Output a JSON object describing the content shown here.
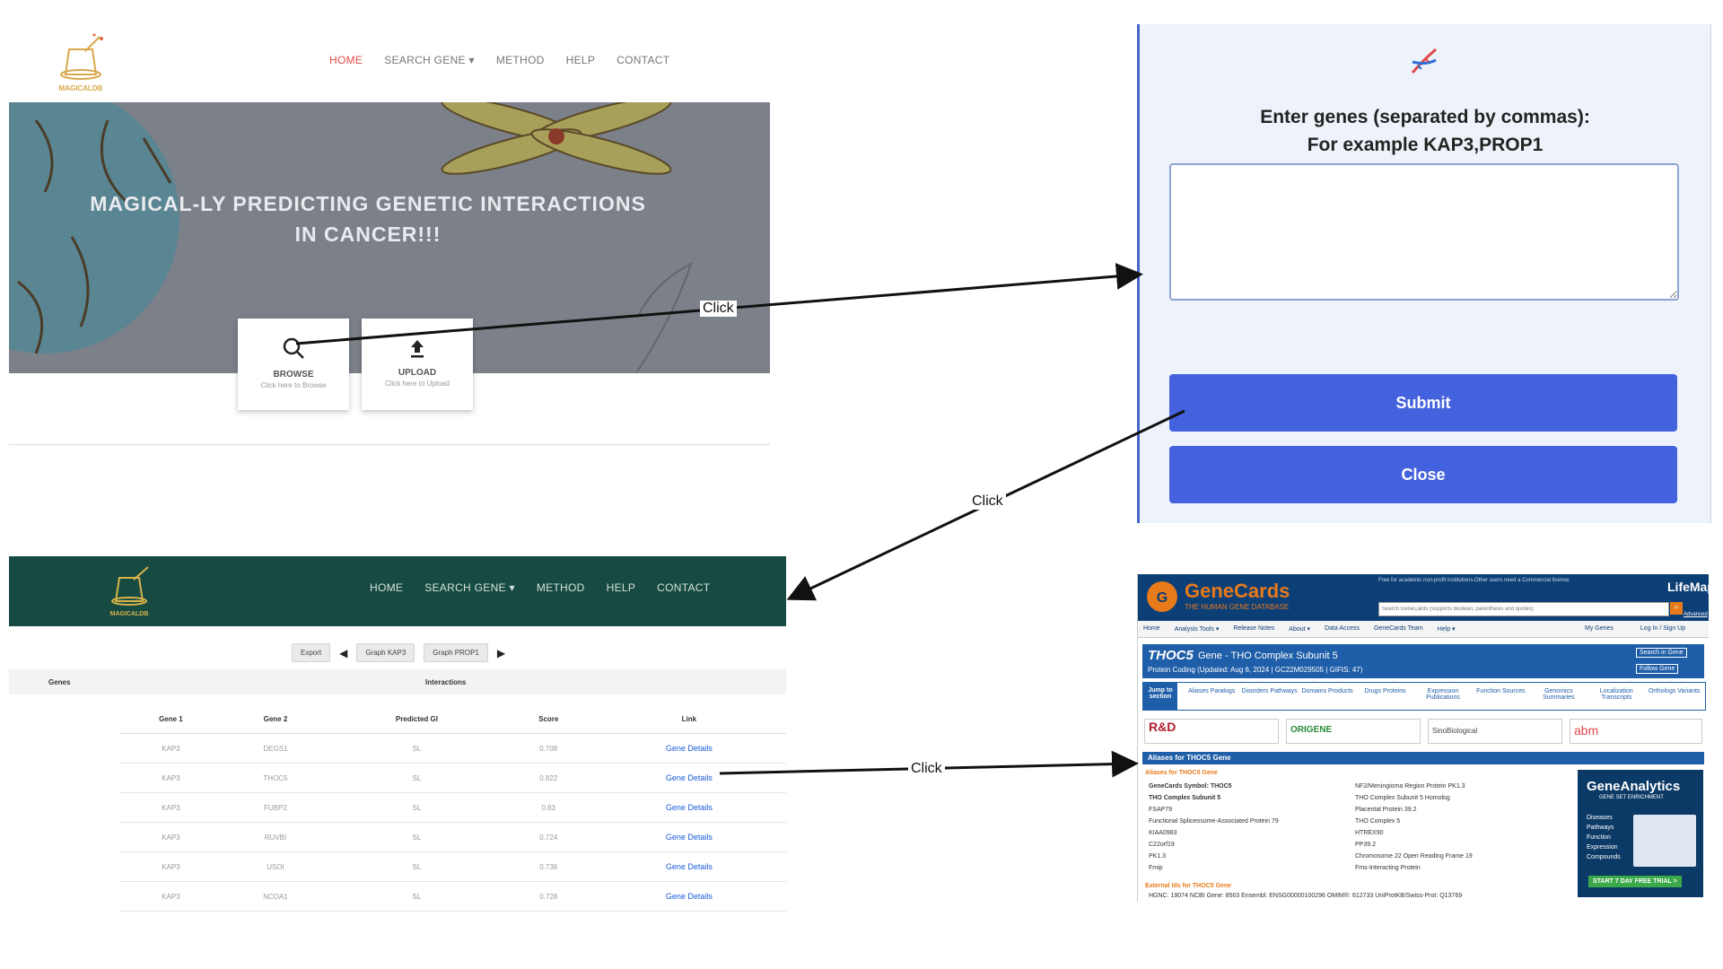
{
  "magicaldb_home": {
    "logo_text": "MAGICALDB",
    "nav": [
      "HOME",
      "SEARCH GENE ▾",
      "METHOD",
      "HELP",
      "CONTACT"
    ],
    "hero_line1": "MAGICAL-LY PREDICTING GENETIC INTERACTIONS",
    "hero_line2": "IN CANCER!!!",
    "browse_title": "BROWSE",
    "browse_sub": "Click here to Browse",
    "upload_title": "UPLOAD",
    "upload_sub": "Click here to Upload"
  },
  "gene_dialog": {
    "prompt_line1": "Enter genes (separated by commas):",
    "prompt_line2": "For example KAP3,PROP1",
    "submit": "Submit",
    "close": "Close"
  },
  "results_page": {
    "logo_text": "MAGICALDB",
    "nav": [
      "HOME",
      "SEARCH GENE ▾",
      "METHOD",
      "HELP",
      "CONTACT"
    ],
    "toolbar": {
      "export": "Export",
      "graph1": "Graph KAP3",
      "graph2": "Graph PROP1"
    },
    "header_genes": "Genes",
    "header_interactions": "Interactions",
    "columns": [
      "Gene 1",
      "Gene 2",
      "Predicted GI",
      "Score",
      "Link"
    ],
    "rows": [
      [
        "KAP3",
        "DEGS1",
        "SL",
        "0.708",
        "Gene Details"
      ],
      [
        "KAP3",
        "THOC5",
        "SL",
        "0.822",
        "Gene Details"
      ],
      [
        "KAP3",
        "FUBP2",
        "SL",
        "0.83",
        "Gene Details"
      ],
      [
        "KAP3",
        "RUVBI",
        "SL",
        "0.724",
        "Gene Details"
      ],
      [
        "KAP3",
        "USOI",
        "SL",
        "0.736",
        "Gene Details"
      ],
      [
        "KAP3",
        "NCOA1",
        "SL",
        "0.728",
        "Gene Details"
      ]
    ]
  },
  "genecards": {
    "brand": "GeneCards",
    "tagline": "THE HUMAN GENE DATABASE",
    "top_note": "Free for academic non-profit institutions.Other users need a Commercial license",
    "search_placeholder": "Search GeneCards (supports boolean, parenthesis and quotes)",
    "lifemap": "LifeMap",
    "advanced": "Advanced",
    "nav": [
      "Home",
      "Analysis Tools ▾",
      "Release Notes",
      "About ▾",
      "Data Access",
      "GeneCards Team",
      "Help ▾"
    ],
    "nav_right": [
      "My Genes",
      "Log In / Sign Up"
    ],
    "gene_symbol": "THOC5",
    "gene_title": "Gene - THO Complex Subunit 5",
    "gene_meta": "Protein Coding (Updated: Aug 6, 2024 | GC22M029505 | GIFtS: 47)",
    "search_in_gene": "Search in Gene",
    "follow_gene": "Follow Gene",
    "jump_label": "Jump to section",
    "jump_items": [
      "Aliases Paralogs",
      "Disorders Pathways",
      "Domains Products",
      "Drugs Proteins",
      "Expression Publications",
      "Function Sources",
      "Genomics Summaries",
      "Localization Transcripts",
      "Orthologs Variants"
    ],
    "vendors": [
      "R&D",
      "ORIGENE",
      "SinoBiological",
      "abm"
    ],
    "section_title": "Aliases for THOC5 Gene",
    "aliases_heading": "Aliases for THOC5 Gene",
    "aliases_left": [
      "GeneCards Symbol: THOC5",
      "THO Complex Subunit 5",
      "FSAP79",
      "Functional Spliceosome-Associated Protein 79",
      "KIAA0983",
      "C22orf19",
      "PK1.3",
      "Fmip"
    ],
    "aliases_right": [
      "NF2/Meningioma Region Protein PK1.3",
      "THO Complex Subunit 5 Homolog",
      "Placental Protein 39.2",
      "THO Complex 5",
      "HTREX90",
      "PP39.2",
      "Chromosome 22 Open Reading Frame 19",
      "Fms-Interacting Protein"
    ],
    "external_heading": "External Ids for THOC5 Gene",
    "external_ids": "HGNC: 19074  NCBI Gene: 8563  Ensembl: ENSG00000100296  OMIM®: 612733  UniProtKB/Swiss-Prot: Q13769",
    "ad_title": "GeneAnalytics",
    "ad_sub": "GENE SET ENRICHMENT",
    "ad_items": [
      "Diseases",
      "Pathways",
      "Function",
      "Expression",
      "Compounds"
    ],
    "ad_cta": "START 7 DAY FREE TRIAL >"
  },
  "annotations": {
    "click1": "Click",
    "click2": "Click",
    "click3": "Click"
  }
}
